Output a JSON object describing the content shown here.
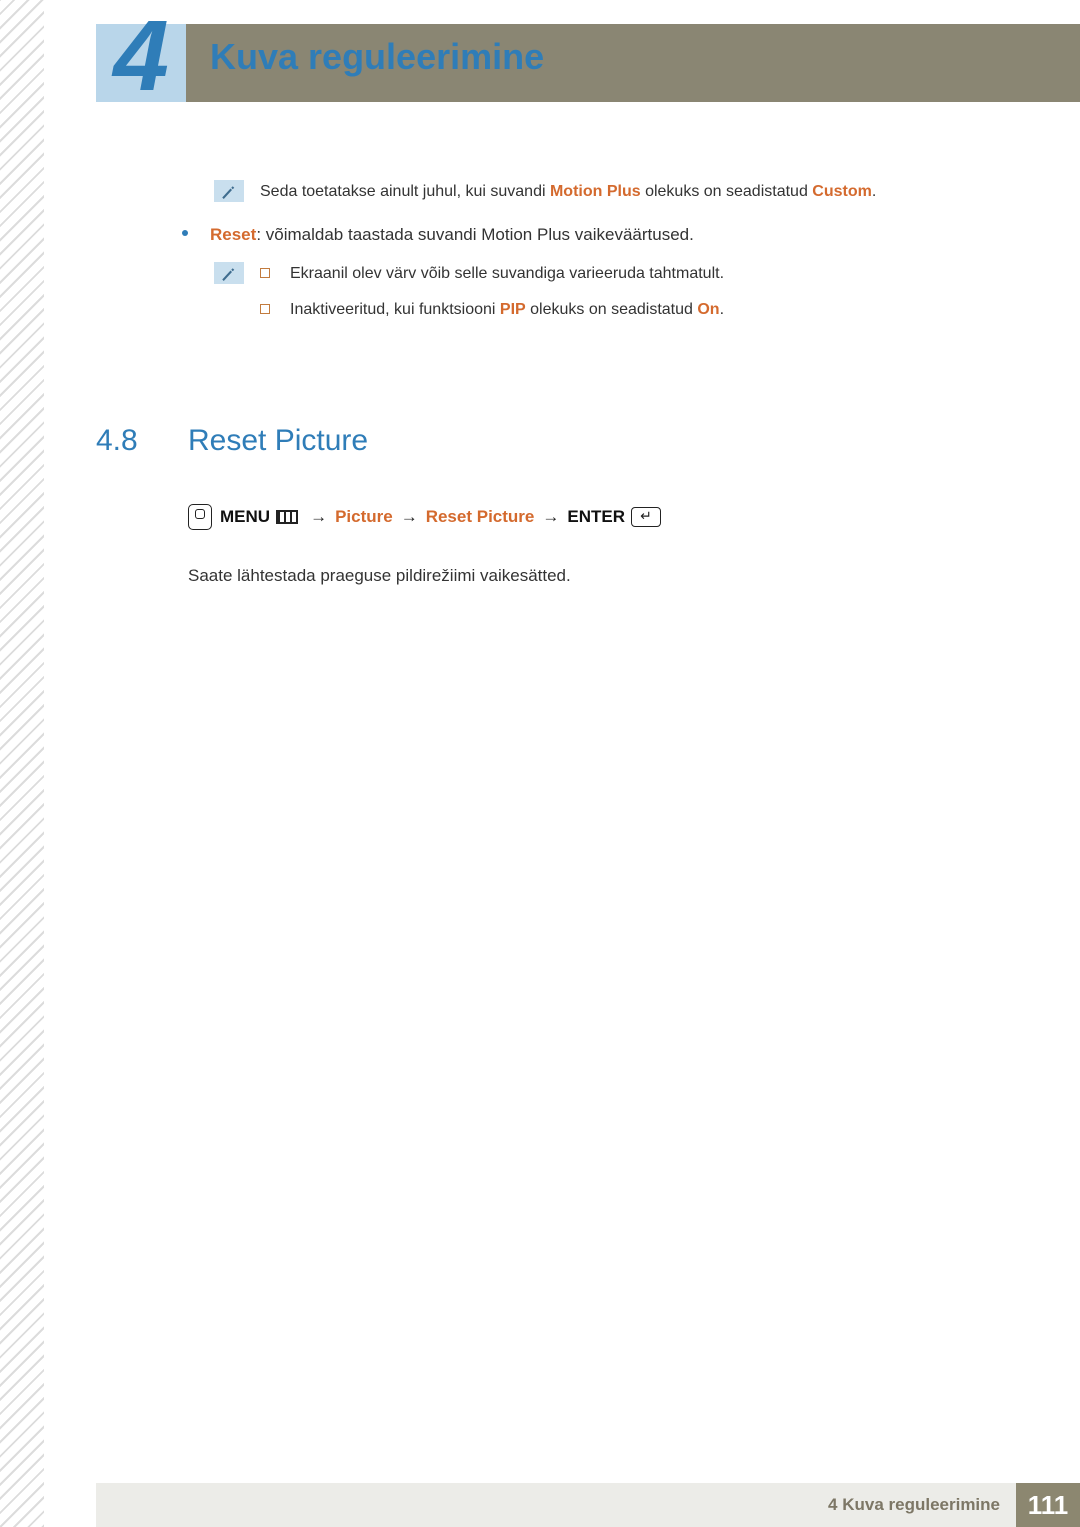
{
  "chapter": {
    "number": "4",
    "title": "Kuva reguleerimine"
  },
  "note1": {
    "prefix": "Seda toetatakse ainult juhul, kui suvandi ",
    "em1": "Motion Plus",
    "mid": " olekuks on seadistatud ",
    "em2": "Custom",
    "suffix": "."
  },
  "bullet": {
    "label": "Reset",
    "text": ": võimaldab taastada suvandi Motion Plus vaikeväärtused."
  },
  "sublist": {
    "item1": "Ekraanil olev värv võib selle suvandiga varieeruda tahtmatult.",
    "item2_prefix": "Inaktiveeritud, kui funktsiooni ",
    "item2_em1": "PIP",
    "item2_mid": " olekuks on seadistatud ",
    "item2_em2": "On",
    "item2_suffix": "."
  },
  "section": {
    "num": "4.8",
    "title": "Reset Picture"
  },
  "nav": {
    "menu": "MENU",
    "p1": "Picture",
    "p2": "Reset Picture",
    "enter": "ENTER"
  },
  "body": "Saate lähtestada praeguse pildirežiimi vaikesätted.",
  "footer": {
    "label": "4 Kuva reguleerimine",
    "page": "111"
  }
}
